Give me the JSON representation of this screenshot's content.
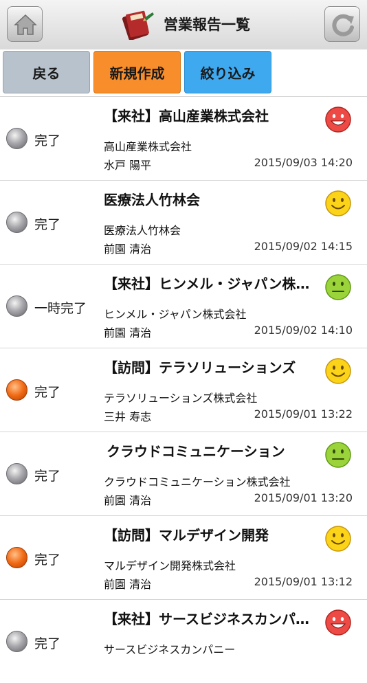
{
  "header": {
    "title": "営業報告一覧",
    "home_icon": "home-icon",
    "reload_icon": "reload-icon",
    "diary_icon": "diary-book-icon"
  },
  "toolbar": {
    "back_label": "戻る",
    "new_label": "新規作成",
    "filter_label": "絞り込み",
    "colors": {
      "back": "#b8c2cc",
      "new": "#f78d2b",
      "filter": "#3fa9f0"
    }
  },
  "reports": [
    {
      "status": "完了",
      "status_color": "gray",
      "title": "【来社】高山産業株式会社",
      "company": "高山産業株式会社",
      "person": "水戸 陽平",
      "datetime": "2015/09/03 14:20",
      "mood": "happy"
    },
    {
      "status": "完了",
      "status_color": "gray",
      "title": "医療法人竹林会",
      "company": "医療法人竹林会",
      "person": "前園 清治",
      "datetime": "2015/09/02 14:15",
      "mood": "smile"
    },
    {
      "status": "一時完了",
      "status_color": "gray",
      "title": "【来社】ヒンメル・ジャパン株…",
      "company": "ヒンメル・ジャパン株式会社",
      "person": "前園 清治",
      "datetime": "2015/09/02 14:10",
      "mood": "neutral"
    },
    {
      "status": "完了",
      "status_color": "orange",
      "title": "【訪問】テラソリューションズ",
      "company": "テラソリューションズ株式会社",
      "person": "三井 寿志",
      "datetime": "2015/09/01 13:22",
      "mood": "smile"
    },
    {
      "status": "完了",
      "status_color": "gray",
      "title": "クラウドコミュニケーション",
      "company": "クラウドコミュニケーション株式会社",
      "person": "前園 清治",
      "datetime": "2015/09/01 13:20",
      "mood": "neutral"
    },
    {
      "status": "完了",
      "status_color": "orange",
      "title": "【訪問】マルデザイン開発",
      "company": "マルデザイン開発株式会社",
      "person": "前園 清治",
      "datetime": "2015/09/01 13:12",
      "mood": "smile"
    },
    {
      "status": "完了",
      "status_color": "gray",
      "title": "【来社】サースビジネスカンパ…",
      "company": "サースビジネスカンパニー",
      "person": "",
      "datetime": "",
      "mood": "happy"
    }
  ]
}
